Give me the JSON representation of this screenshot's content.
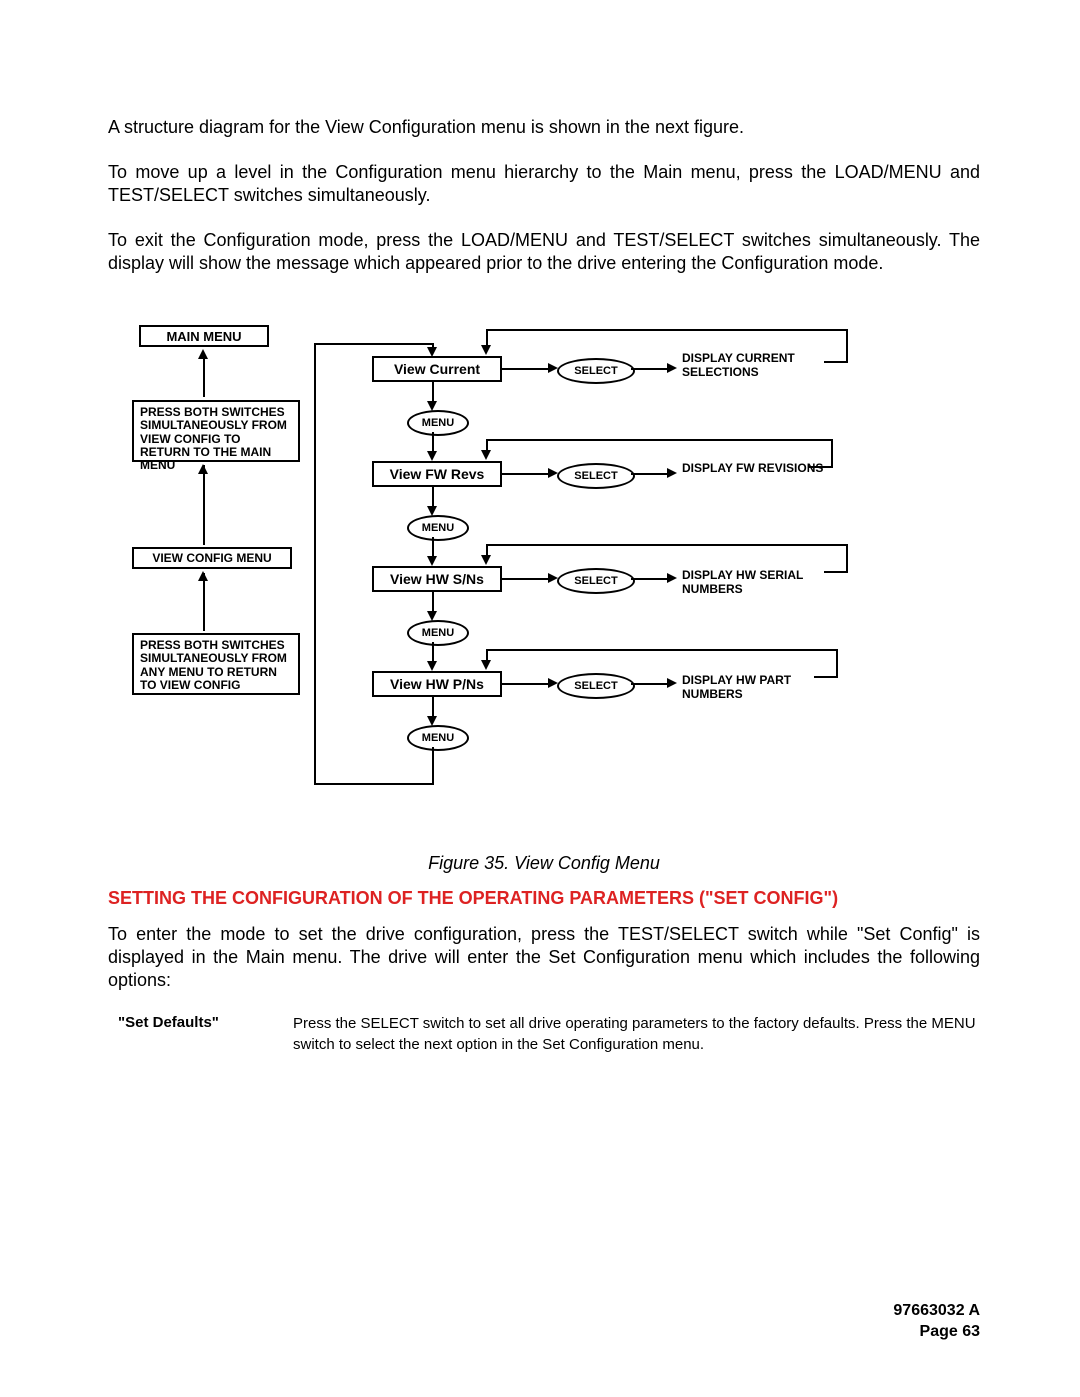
{
  "paragraphs": {
    "p1": "A structure diagram for the View Configuration menu is shown in the next figure.",
    "p2": "To move up a level in the Configuration menu hierarchy to the Main menu, press the LOAD/MENU and TEST/SELECT switches simultaneously.",
    "p3": "To exit the Configuration mode, press the LOAD/MENU and TEST/SELECT switches simultaneously. The display will show the message which appeared prior to the drive entering the Configuration mode."
  },
  "diagram": {
    "main_menu": "MAIN MENU",
    "note_top": "PRESS BOTH SWITCHES SIMULTANEOUSLY FROM VIEW CONFIG TO RETURN TO THE MAIN MENU",
    "view_config_menu": "VIEW CONFIG MENU",
    "note_bottom": "PRESS BOTH SWITCHES SIMULTANEOUSLY FROM ANY MENU TO RETURN TO VIEW CONFIG",
    "rows": [
      {
        "menu": "View Current",
        "select": "SELECT",
        "display": "DISPLAY CURRENT SELECTIONS",
        "menuBtn": "MENU"
      },
      {
        "menu": "View FW Revs",
        "select": "SELECT",
        "display": "DISPLAY  FW REVISIONS",
        "menuBtn": "MENU"
      },
      {
        "menu": "View HW S/Ns",
        "select": "SELECT",
        "display": "DISPLAY  HW SERIAL NUMBERS",
        "menuBtn": "MENU"
      },
      {
        "menu": "View HW P/Ns",
        "select": "SELECT",
        "display": "DISPLAY  HW PART NUMBERS",
        "menuBtn": "MENU"
      }
    ]
  },
  "figure_caption": "Figure 35. View Config Menu",
  "section_title": "SETTING THE CONFIGURATION OF THE OPERATING PARAMETERS (\"SET CONFIG\")",
  "section_body": "To enter the mode to set the drive configuration, press the TEST/SELECT switch while \"Set Config\" is displayed in the Main menu. The drive will enter the Set Configuration menu which includes the following options:",
  "option": {
    "label": "\"Set Defaults\"",
    "desc": "Press the SELECT switch to set all drive operating parameters to the factory defaults. Press the MENU switch to select the next option in the Set Configuration menu."
  },
  "footer": {
    "doc": "97663032 A",
    "page": "Page 63"
  }
}
